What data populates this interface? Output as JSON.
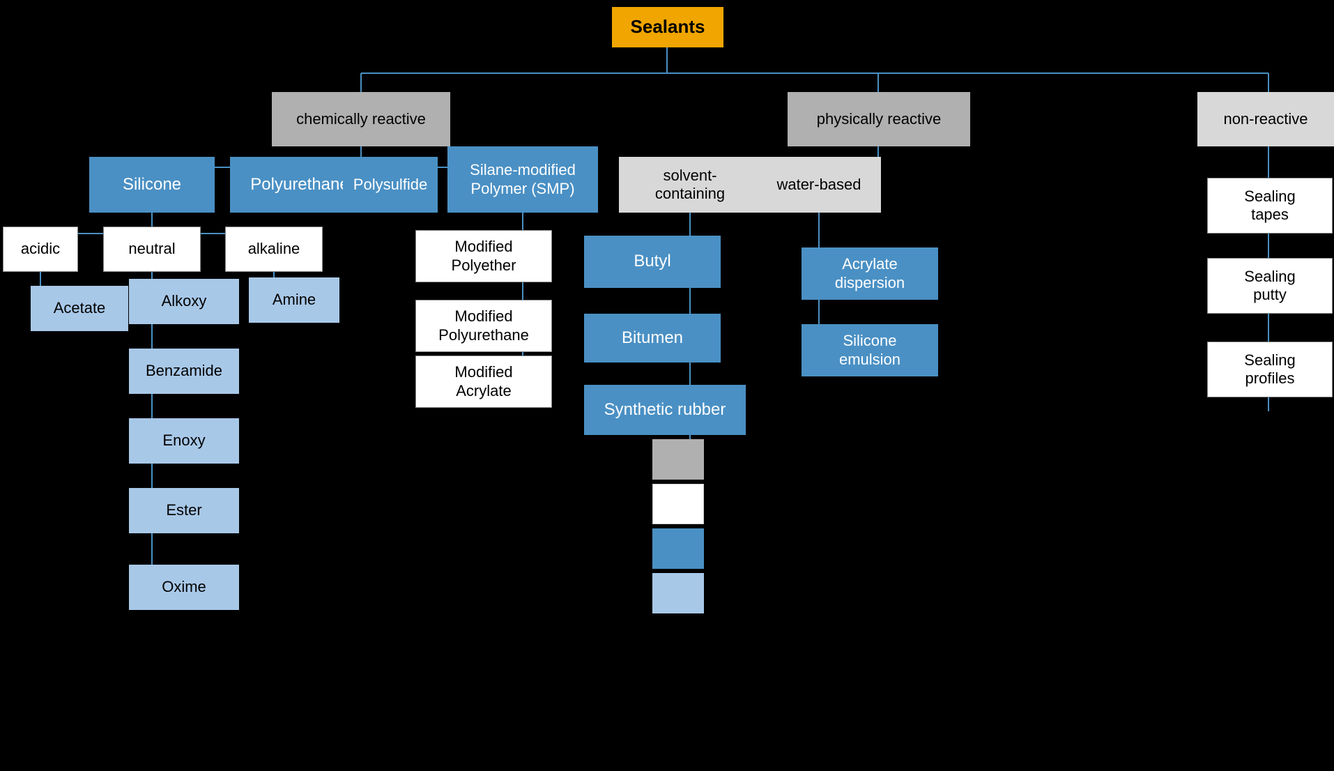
{
  "nodes": {
    "sealants": {
      "label": "Sealants"
    },
    "chemically_reactive": {
      "label": "chemically reactive"
    },
    "physically_reactive": {
      "label": "physically reactive"
    },
    "non_reactive": {
      "label": "non-reactive"
    },
    "silicone": {
      "label": "Silicone"
    },
    "polyurethane": {
      "label": "Polyurethane"
    },
    "polysulfide": {
      "label": "Polysulfide"
    },
    "smp": {
      "label": "Silane-modified\nPolymer (SMP)"
    },
    "solvent_containing": {
      "label": "solvent-\ncontaining"
    },
    "water_based": {
      "label": "water-based"
    },
    "acidic": {
      "label": "acidic"
    },
    "neutral": {
      "label": "neutral"
    },
    "alkaline": {
      "label": "alkaline"
    },
    "modified_polyether": {
      "label": "Modified\nPolyether"
    },
    "modified_polyurethane": {
      "label": "Modified\nPolyurethane"
    },
    "modified_acrylate": {
      "label": "Modified\nAcrylate"
    },
    "butyl": {
      "label": "Butyl"
    },
    "bitumen": {
      "label": "Bitumen"
    },
    "synthetic_rubber": {
      "label": "Synthetic rubber"
    },
    "acrylate_dispersion": {
      "label": "Acrylate\ndispersion"
    },
    "silicone_emulsion": {
      "label": "Silicone\nemulsion"
    },
    "sealing_tapes": {
      "label": "Sealing\ntapes"
    },
    "sealing_putty": {
      "label": "Sealing\nputty"
    },
    "sealing_profiles": {
      "label": "Sealing\nprofiles"
    },
    "acetate": {
      "label": "Acetate"
    },
    "alkoxy": {
      "label": "Alkoxy"
    },
    "benzamide": {
      "label": "Benzamide"
    },
    "enoxy": {
      "label": "Enoxy"
    },
    "ester": {
      "label": "Ester"
    },
    "oxime": {
      "label": "Oxime"
    },
    "amine": {
      "label": "Amine"
    }
  },
  "legend": {
    "items": [
      {
        "color": "#B0B0B0",
        "label": ""
      },
      {
        "color": "#fff",
        "label": ""
      },
      {
        "color": "#4A90C4",
        "label": ""
      },
      {
        "color": "#A8C8E8",
        "label": ""
      }
    ]
  }
}
